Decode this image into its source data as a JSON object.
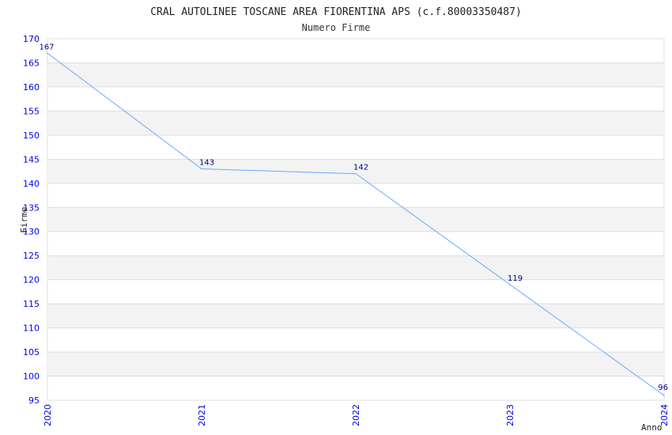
{
  "chart_data": {
    "type": "line",
    "title": "CRAL AUTOLINEE TOSCANE AREA FIORENTINA APS (c.f.80003350487)",
    "subtitle": "Numero Firme",
    "xlabel": "Anno",
    "ylabel": "Firme",
    "categories": [
      "2020",
      "2021",
      "2022",
      "2023",
      "2024"
    ],
    "values": [
      167,
      143,
      142,
      119,
      96
    ],
    "ylim": [
      95,
      170
    ],
    "ytick_step": 5,
    "grid": true,
    "colors": {
      "line": "#66aaff",
      "band": "#f3f3f3",
      "grid": "#dddddd",
      "ticks": "#0000ee",
      "labels": "#000080"
    }
  }
}
